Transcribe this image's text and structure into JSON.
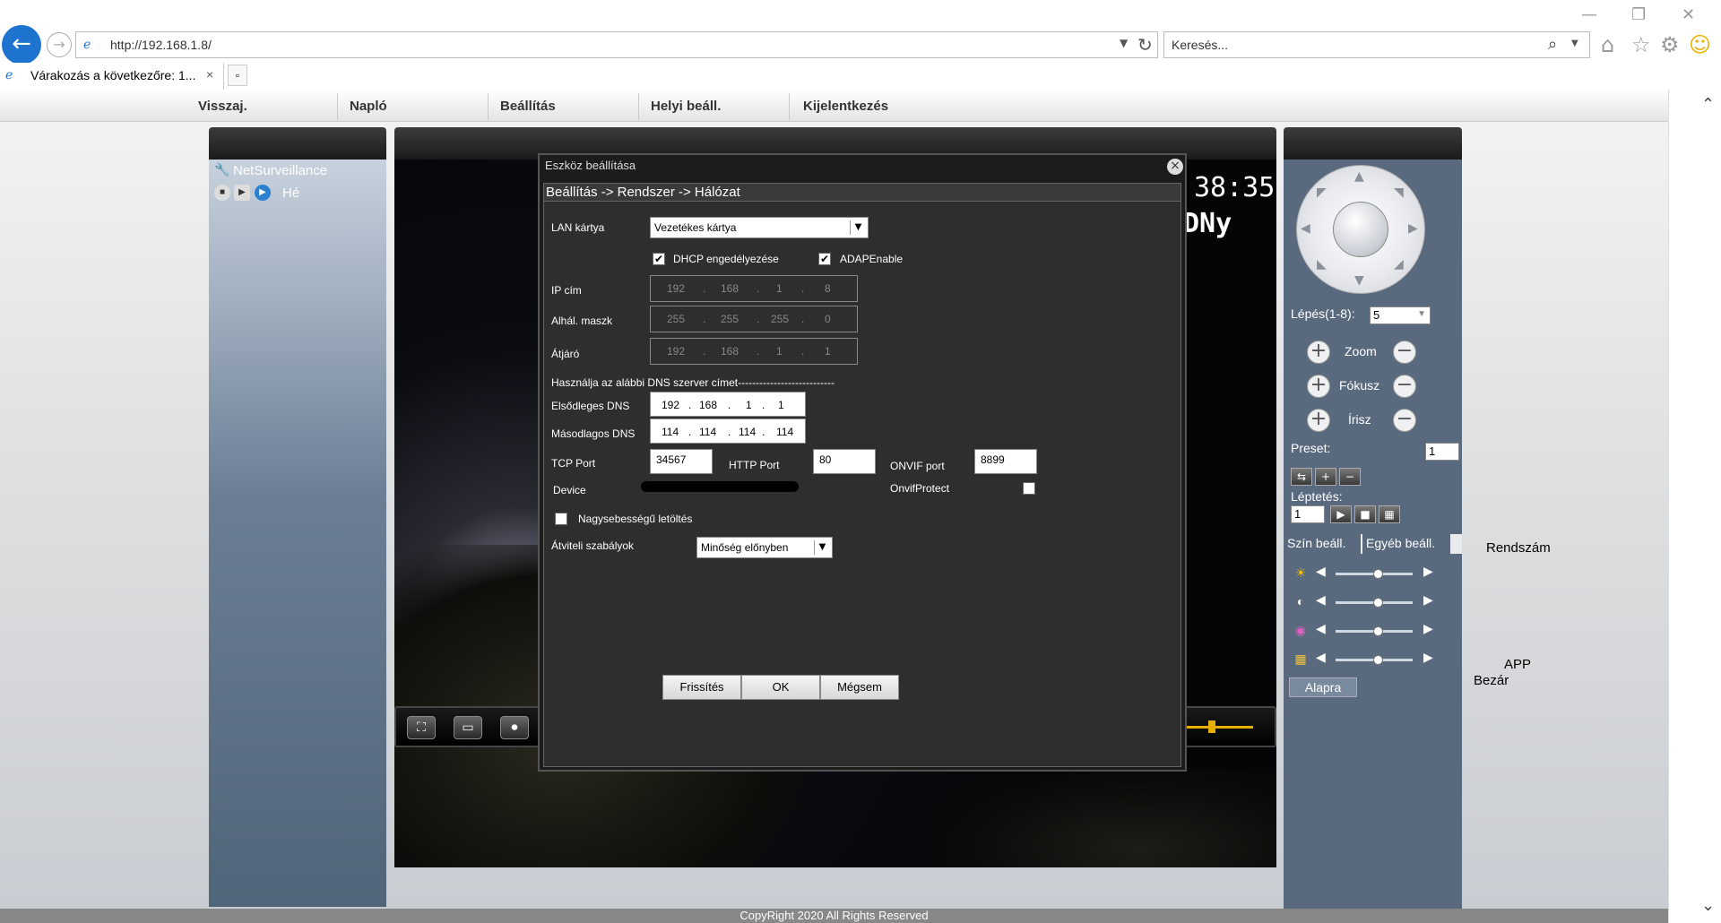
{
  "browser": {
    "url": "http://192.168.1.8/",
    "search_placeholder": "Keresés...",
    "tab_title": "Várakozás a következőre: 1..."
  },
  "menu": [
    "Visszaj.",
    "Napló",
    "Beállítás",
    "Helyi beáll.",
    "Kijelentkezés"
  ],
  "left_panel": {
    "title": "NetSurveillance",
    "channel": "Hé"
  },
  "video": {
    "osd_time": "38:35",
    "osd_text": "DNy"
  },
  "dialog": {
    "title": "Eszköz beállítása",
    "breadcrumb": "Beállítás -> Rendszer -> Hálózat",
    "lan_label": "LAN kártya",
    "lan_value": "Vezetékes kártya",
    "dhcp_label": "DHCP engedélyezése",
    "adap_label": "ADAPEnable",
    "ip_label": "IP cím",
    "ip": [
      "192",
      "168",
      "1",
      "8"
    ],
    "mask_label": "Alhál. maszk",
    "mask": [
      "255",
      "255",
      "255",
      "0"
    ],
    "gw_label": "Átjáró",
    "gw": [
      "192",
      "168",
      "1",
      "1"
    ],
    "dns_heading": "Használja az alábbi DNS szerver címet---------------------------",
    "dns1_label": "Elsődleges DNS",
    "dns1": [
      "192",
      "168",
      "1",
      "1"
    ],
    "dns2_label": "Másodlagos DNS",
    "dns2": [
      "114",
      "114",
      "114",
      "114"
    ],
    "tcp_label": "TCP Port",
    "tcp_value": "34567",
    "http_label": "HTTP Port",
    "http_value": "80",
    "onvif_label": "ONVIF port",
    "onvif_value": "8899",
    "device_label": "Device",
    "onvifprotect_label": "OnvifProtect",
    "highspeed_label": "Nagysebességű letöltés",
    "transfer_label": "Átviteli szabályok",
    "transfer_value": "Minőség előnyben",
    "btn_refresh": "Frissítés",
    "btn_ok": "OK",
    "btn_cancel": "Mégsem"
  },
  "right_panel": {
    "step_label": "Lépés(1-8):",
    "step_value": "5",
    "zoom": "Zoom",
    "focus": "Fókusz",
    "iris": "Írisz",
    "preset_label": "Preset:",
    "preset_value": "1",
    "cruise_label": "Léptetés:",
    "cruise_value": "1",
    "tab_color": "Szín beáll.",
    "tab_other": "Egyéb beáll.",
    "default_btn": "Alapra"
  },
  "side_labels": {
    "rendszam": "Rendszám",
    "app": "APP",
    "bezar": "Bezár"
  },
  "footer": "CopyRight 2020 All Rights Reserved"
}
